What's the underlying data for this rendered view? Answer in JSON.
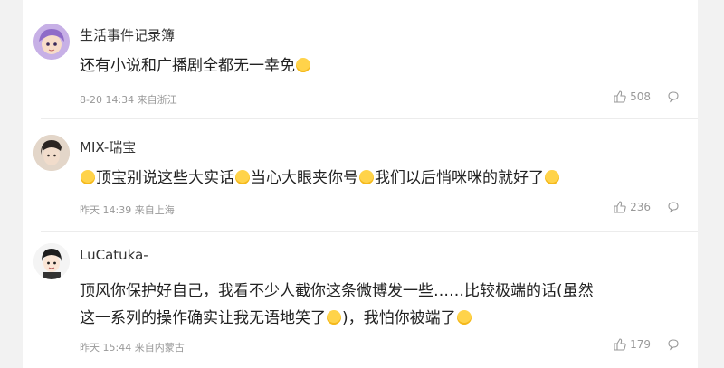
{
  "comments": [
    {
      "username": "生活事件记录簿",
      "text": "还有小说和广播剧全都无一幸免",
      "date": "8-20 14:34",
      "location": "来自浙江",
      "likes": "508",
      "avatar_icon": "anime-girl-avatar",
      "emoji_icon": "laughing-tears-emoji"
    },
    {
      "username": "MIX-瑞宝",
      "text_parts": [
        "顶宝别说这些大实话",
        "当心大眼夹你号",
        "我们以后悄咪咪的就好了"
      ],
      "date": "昨天 14:39",
      "location": "来自上海",
      "likes": "236",
      "avatar_icon": "portrait-avatar",
      "emoji_icon": "thinking-emoji"
    },
    {
      "username": "LuCatuka-",
      "text_line1": "顶风你保护好自己，我看不少人截你这条微博发一些……比较极端的话(虽然",
      "text_line2a": "这一系列的操作确实让我无语地笑了",
      "text_line2b": ")，我怕你被端了",
      "date": "昨天 15:44",
      "location": "来自内蒙古",
      "likes": "179",
      "avatar_icon": "cartoon-boy-avatar",
      "emoji_icons": [
        "smile-emoji",
        "laughing-tears-emoji"
      ]
    }
  ],
  "colors": {
    "panel": "#ffffff",
    "background": "#f2f2f2",
    "meta": "#999999",
    "emoji": "#ffd34a"
  }
}
